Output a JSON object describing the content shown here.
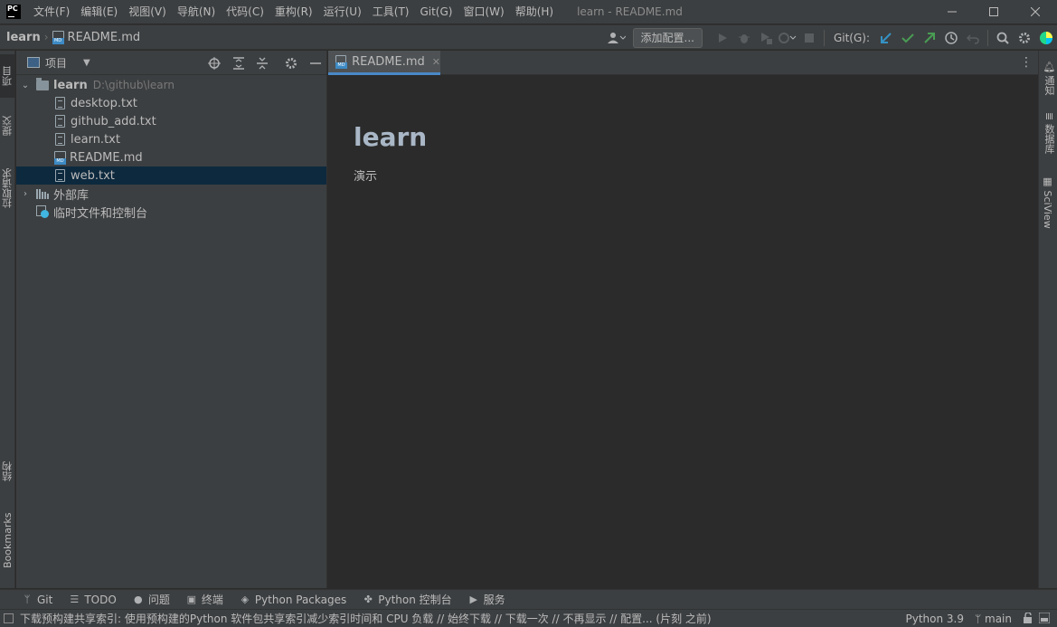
{
  "menubar": {
    "logo_text": "PC",
    "items": [
      "文件(F)",
      "编辑(E)",
      "视图(V)",
      "导航(N)",
      "代码(C)",
      "重构(R)",
      "运行(U)",
      "工具(T)",
      "Git(G)",
      "窗口(W)",
      "帮助(H)"
    ],
    "window_title": "learn - README.md"
  },
  "navbar": {
    "project": "learn",
    "file": "README.md",
    "add_config": "添加配置...",
    "git_label": "Git(G):"
  },
  "left_strip": {
    "project": "项目",
    "commit": "提交",
    "pull_requests": "拉取请求",
    "structure": "结构",
    "bookmarks": "Bookmarks"
  },
  "right_strip": {
    "notifications": "通知",
    "database": "数据库",
    "sciview": "SciView"
  },
  "project_panel": {
    "title": "项目",
    "root": {
      "name": "learn",
      "path": "D:\\github\\learn"
    },
    "files": [
      "desktop.txt",
      "github_add.txt",
      "learn.txt",
      "README.md",
      "web.txt"
    ],
    "external_libs": "外部库",
    "scratches": "临时文件和控制台"
  },
  "editor": {
    "tab_label": "README.md",
    "heading": "learn",
    "paragraph": "演示"
  },
  "bottom_tools": [
    {
      "icon": "git-icon",
      "label": "Git"
    },
    {
      "icon": "todo-icon",
      "label": "TODO"
    },
    {
      "icon": "problems-icon",
      "label": "问题"
    },
    {
      "icon": "terminal-icon",
      "label": "终端"
    },
    {
      "icon": "packages-icon",
      "label": "Python Packages"
    },
    {
      "icon": "python-console-icon",
      "label": "Python 控制台"
    },
    {
      "icon": "services-icon",
      "label": "服务"
    }
  ],
  "statusbar": {
    "message": "下载预构建共享索引: 使用预构建的Python 软件包共享索引减少索引时间和 CPU 负载 // 始终下载 // 下载一次 // 不再显示 // 配置... (片刻 之前)",
    "interpreter": "Python 3.9",
    "branch": "main"
  },
  "colors": {
    "accent": "#4a88c7",
    "selection": "#0d293e",
    "panel": "#3c3f41",
    "editor_bg": "#2b2b2b"
  }
}
